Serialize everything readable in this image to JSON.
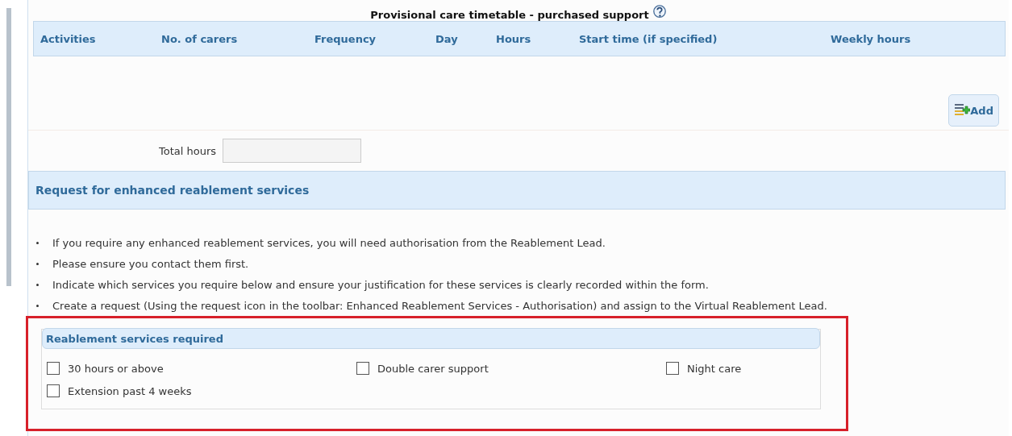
{
  "timetable": {
    "title": "Provisional care timetable - purchased support",
    "columns": [
      "Activities",
      "No. of carers",
      "Frequency",
      "Day",
      "Hours",
      "Start time (if specified)",
      "Weekly hours"
    ],
    "add_button": "Add",
    "total_hours": {
      "label": "Total hours"
    }
  },
  "enhanced_services": {
    "heading": "Request for enhanced reablement services",
    "bullets": [
      "If you require any enhanced reablement services, you will need authorisation from the Reablement Lead.",
      "Please ensure you contact them first.",
      "Indicate which services you require below and ensure your justification for these services is clearly recorded within the form.",
      "Create a request (Using the request icon in the toolbar: Enhanced Reablement Services - Authorisation) and assign to the Virtual Reablement Lead."
    ],
    "required": {
      "legend": "Reablement services required",
      "options": [
        {
          "label": "30 hours or above",
          "checked": false
        },
        {
          "label": "Double carer support",
          "checked": false
        },
        {
          "label": "Night care",
          "checked": false
        },
        {
          "label": "Extension past 4 weeks",
          "checked": false
        }
      ]
    }
  },
  "highlight": {
    "kind": "frame"
  }
}
